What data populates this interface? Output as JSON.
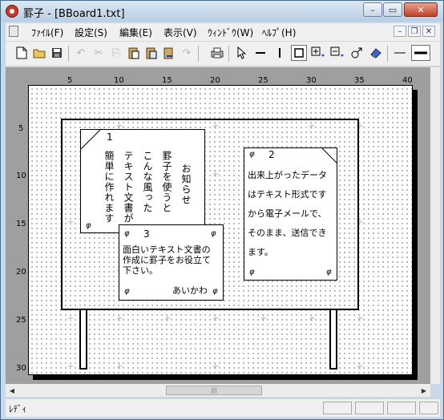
{
  "window": {
    "title": "罫子 - [BBoard1.txt]",
    "min": "–",
    "max": "▭",
    "close": "✕"
  },
  "menu": {
    "items": [
      "ﾌｧｲﾙ(F)",
      "設定(S)",
      "編集(E)",
      "表示(V)",
      "ｳｨﾝﾄﾞｳ(W)",
      "ﾍﾙﾌﾟ(H)"
    ],
    "doc_min": "–",
    "doc_restore": "❐",
    "doc_close": "✕"
  },
  "toolbar": {
    "icons": [
      "new-file-icon",
      "open-folder-icon",
      "save-icon",
      "undo-icon",
      "cut-icon",
      "copy-icon",
      "paste-icon",
      "paste-special-icon",
      "redo-icon",
      "redo-2-icon",
      "print-icon",
      "pointer-icon",
      "hline-icon",
      "vline-icon",
      "box-icon",
      "text-vertical-icon",
      "text-horizontal-icon",
      "link-icon",
      "eraser-icon",
      "thin-line-icon",
      "thick-line-icon"
    ]
  },
  "ruler": {
    "top": [
      "5",
      "10",
      "15",
      "20",
      "25",
      "30",
      "35",
      "40"
    ],
    "left": [
      "5",
      "10",
      "15",
      "20",
      "25",
      "30"
    ]
  },
  "cards": {
    "card1": {
      "number": "1",
      "phi": "φ",
      "lines": [
        "お知らせ",
        "罫子を使うと",
        "こんな風った",
        "テキスト文書が",
        "簡単に作れます"
      ]
    },
    "card2": {
      "phi_tl": "φ",
      "number": "2",
      "phi_bl": "φ",
      "phi_br": "φ",
      "lines": [
        "出来上がったデータ",
        "はテキスト形式です",
        "から電子メールで、",
        "そのまま、送信でき",
        "ます。"
      ]
    },
    "card3": {
      "phi_tl": "φ",
      "number": "3",
      "phi_tr": "φ",
      "phi_bl": "φ",
      "signature": "あいかわ",
      "phi_br": "φ",
      "lines": [
        "面白いテキスト文書の",
        "作成に罫子をお役立て",
        "下さい。"
      ]
    }
  },
  "hscroll": {
    "grip": "|||"
  },
  "status": {
    "text": "ﾚﾃﾞｨ"
  }
}
